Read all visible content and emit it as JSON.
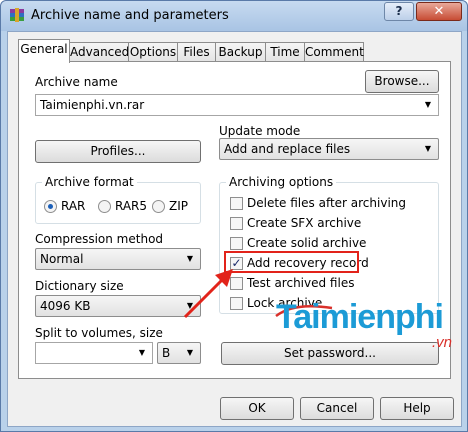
{
  "window": {
    "title": "Archive name and parameters",
    "help_label": "?",
    "close_label": "✕"
  },
  "tabs": [
    {
      "label": "General",
      "active": true
    },
    {
      "label": "Advanced"
    },
    {
      "label": "Options"
    },
    {
      "label": "Files"
    },
    {
      "label": "Backup"
    },
    {
      "label": "Time"
    },
    {
      "label": "Comment"
    }
  ],
  "general": {
    "archive_name_label": "Archive name",
    "browse_label": "Browse...",
    "archive_name_value": "Taimienphi.vn.rar",
    "update_mode_label": "Update mode",
    "profiles_label": "Profiles...",
    "update_mode_value": "Add and replace files",
    "archive_format": {
      "title": "Archive format",
      "options": [
        "RAR",
        "RAR5",
        "ZIP"
      ],
      "selected": "RAR"
    },
    "archiving_options": {
      "title": "Archiving options",
      "items": [
        {
          "label": "Delete files after archiving",
          "checked": false
        },
        {
          "label": "Create SFX archive",
          "checked": false
        },
        {
          "label": "Create solid archive",
          "checked": false
        },
        {
          "label": "Add recovery record",
          "checked": true,
          "highlighted": true
        },
        {
          "label": "Test archived files",
          "checked": false
        },
        {
          "label": "Lock archive",
          "checked": false
        }
      ]
    },
    "compression_method_label": "Compression method",
    "compression_method_value": "Normal",
    "dictionary_size_label": "Dictionary size",
    "dictionary_size_value": "4096 KB",
    "split_label": "Split to volumes, size",
    "split_value": "",
    "split_unit": "B",
    "set_password_label": "Set password..."
  },
  "footer": {
    "ok_label": "OK",
    "cancel_label": "Cancel",
    "help_label": "Help"
  },
  "watermark": {
    "brand": "Taimienphi",
    "suffix": ".vn"
  },
  "colors": {
    "highlight": "#e2231a",
    "watermark": "#1c9bd6",
    "arrow": "#e2231a"
  }
}
